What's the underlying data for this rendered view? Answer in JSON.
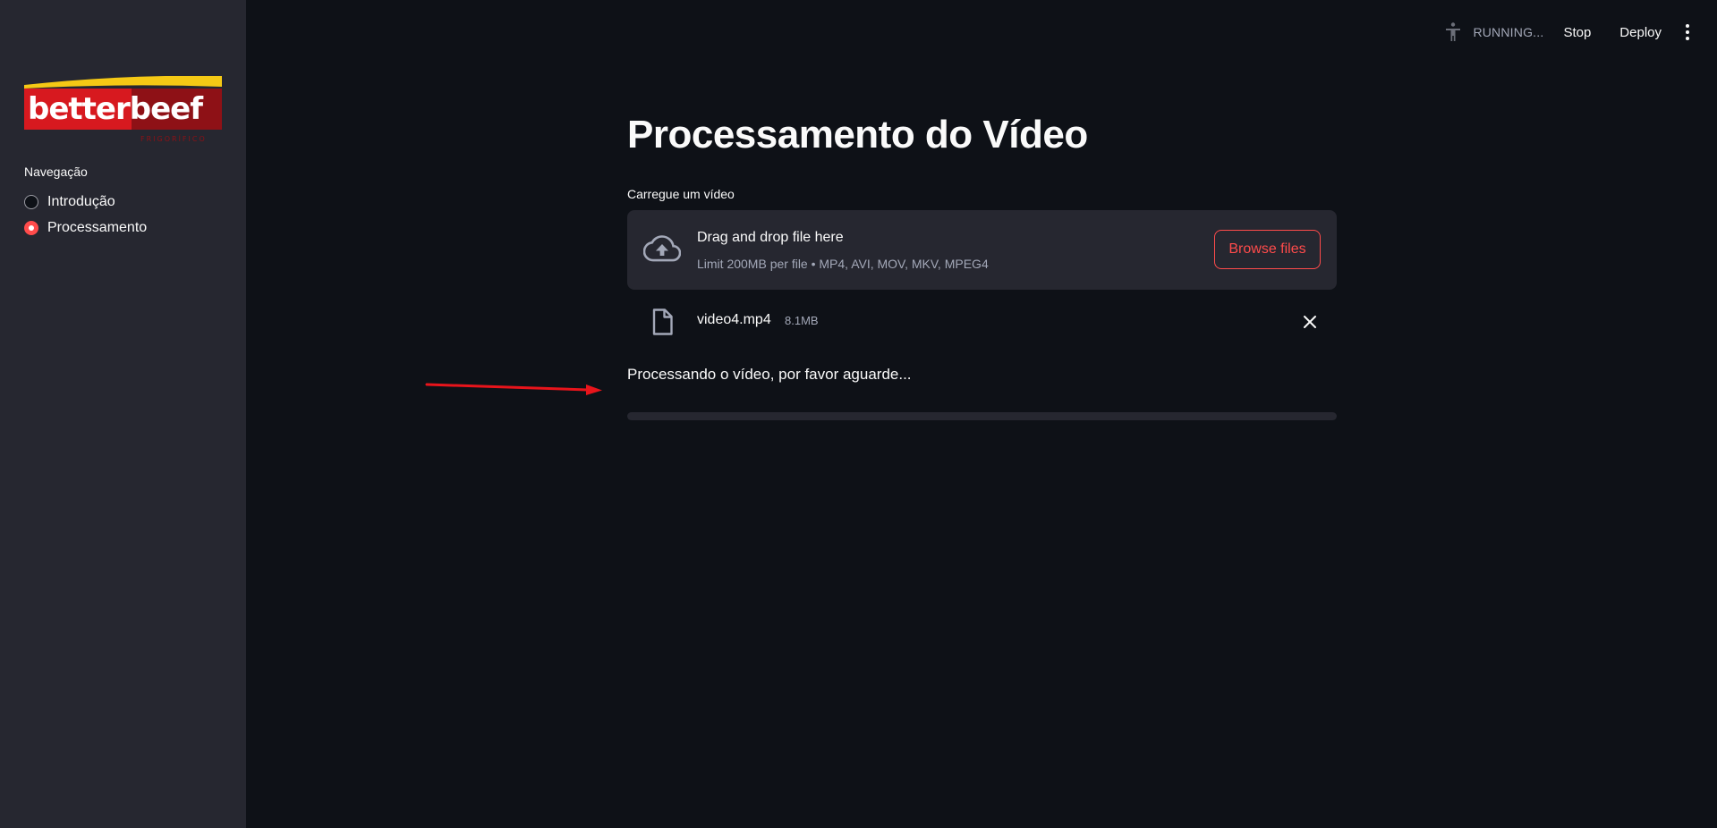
{
  "sidebar": {
    "logo": {
      "text": "betterbeef",
      "subtext": "FRIGORÍFICO",
      "colors": {
        "red": "#d7191f",
        "dark_red": "#8e1116",
        "yellow": "#f5c915"
      }
    },
    "nav_title": "Navegação",
    "items": [
      {
        "label": "Introdução",
        "selected": false
      },
      {
        "label": "Processamento",
        "selected": true
      }
    ]
  },
  "header": {
    "running_icon": "running-man-icon",
    "status": "RUNNING...",
    "stop_label": "Stop",
    "deploy_label": "Deploy",
    "menu_icon": "kebab-menu-icon"
  },
  "main": {
    "title": "Processamento do Vídeo",
    "uploader": {
      "label": "Carregue um vídeo",
      "icon": "cloud-upload-icon",
      "dropzone_title": "Drag and drop file here",
      "limit_text": "Limit 200MB per file • MP4, AVI, MOV, MKV, MPEG4",
      "browse_label": "Browse files"
    },
    "file": {
      "icon": "file-icon",
      "name": "video4.mp4",
      "size": "8.1MB",
      "remove_icon": "close-icon"
    },
    "status_text": "Processando o vídeo, por favor aguarde...",
    "progress": 0
  },
  "colors": {
    "background": "#0e1117",
    "sidebar": "#262730",
    "accent": "#ff4b4b",
    "muted_text": "#a3a8b8",
    "annotation_arrow": "#e8141b"
  }
}
